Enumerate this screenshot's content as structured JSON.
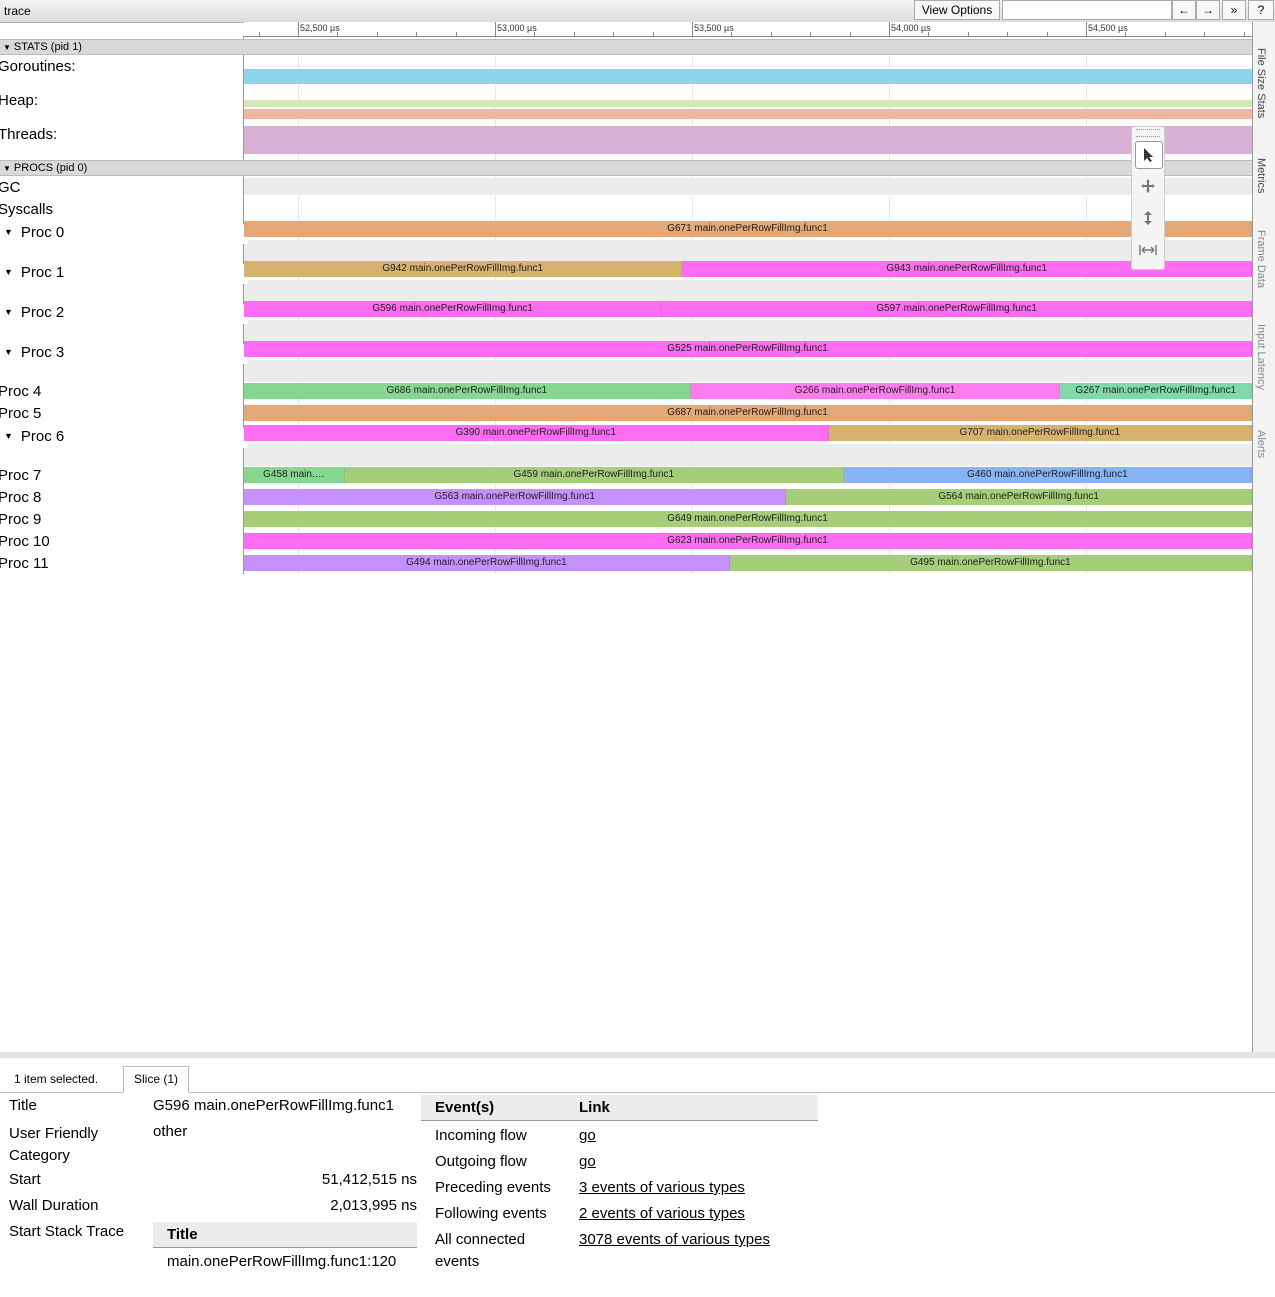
{
  "header": {
    "title": "trace",
    "view_options": "View Options",
    "search_value": "",
    "nav_back": "←",
    "nav_forward": "→",
    "nav_more": "»",
    "help": "?"
  },
  "ruler": {
    "ticks": [
      {
        "label": "52,500 µs",
        "value": 52500
      },
      {
        "label": "53,000 µs",
        "value": 53000
      },
      {
        "label": "53,500 µs",
        "value": 53500
      },
      {
        "label": "54,000 µs",
        "value": 54000
      },
      {
        "label": "54,500 µs",
        "value": 54500
      }
    ]
  },
  "stats": {
    "header": "STATS (pid 1)",
    "rows": [
      {
        "label": "Goroutines:",
        "color": "#8ed4ea"
      },
      {
        "label": "Heap:",
        "colors": [
          "#d5e6b8",
          "#eeb8a0"
        ]
      },
      {
        "label": "Threads:",
        "color": "#d8b0d6"
      }
    ]
  },
  "procs": {
    "header": "PROCS (pid 0)",
    "rows": [
      {
        "label": "GC",
        "expandable": false
      },
      {
        "label": "Syscalls",
        "expandable": false
      },
      {
        "label": "Proc 0",
        "expandable": true,
        "slices": [
          {
            "label": "G671 main.onePerRowFillImg.func1",
            "start": 0,
            "end": 1,
            "color": "#e2a878"
          }
        ]
      },
      {
        "label": "Proc 1",
        "expandable": true,
        "slices": [
          {
            "label": "G942 main.onePerRowFillImg.func1",
            "start": 0,
            "end": 0.435,
            "color": "#d5b36e"
          },
          {
            "label": "G943 main.onePerRowFillImg.func1",
            "start": 0.435,
            "end": 1,
            "color": "#fe6cf1"
          }
        ]
      },
      {
        "label": "Proc 2",
        "expandable": true,
        "slices": [
          {
            "label": "G596 main.onePerRowFillImg.func1",
            "start": 0,
            "end": 0.415,
            "color": "#fe6cf1"
          },
          {
            "label": "G597 main.onePerRowFillImg.func1",
            "start": 0.415,
            "end": 1,
            "color": "#fe6cf1"
          }
        ]
      },
      {
        "label": "Proc 3",
        "expandable": true,
        "slices": [
          {
            "label": "G525 main.onePerRowFillImg.func1",
            "start": 0,
            "end": 1,
            "color": "#fe6cf1"
          }
        ]
      },
      {
        "label": "Proc 4",
        "expandable": false,
        "slices": [
          {
            "label": "G686 main.onePerRowFillImg.func1",
            "start": 0,
            "end": 0.443,
            "color": "#86d890"
          },
          {
            "label": "G266 main.onePerRowFillImg.func1",
            "start": 0.443,
            "end": 0.81,
            "color": "#fe7cf0"
          },
          {
            "label": "G267 main.onePerRowFillImg.func1",
            "start": 0.81,
            "end": 1,
            "color": "#7edba9"
          }
        ]
      },
      {
        "label": "Proc 5",
        "expandable": false,
        "slices": [
          {
            "label": "G687 main.onePerRowFillImg.func1",
            "start": 0,
            "end": 1,
            "color": "#e2a878"
          }
        ]
      },
      {
        "label": "Proc 6",
        "expandable": true,
        "slices": [
          {
            "label": "G390 main.onePerRowFillImg.func1",
            "start": 0,
            "end": 0.58,
            "color": "#fe6cf1"
          },
          {
            "label": "G707 main.onePerRowFillImg.func1",
            "start": 0.58,
            "end": 1,
            "color": "#d5b36e"
          }
        ]
      },
      {
        "label": "Proc 7",
        "expandable": false,
        "slices": [
          {
            "label": "G458 main.…",
            "start": 0,
            "end": 0.1,
            "color": "#86d890"
          },
          {
            "label": "G459 main.onePerRowFillImg.func1",
            "start": 0.1,
            "end": 0.595,
            "color": "#a6cd77"
          },
          {
            "label": "G460 main.onePerRowFillImg.func1",
            "start": 0.595,
            "end": 1,
            "color": "#87b4f6"
          }
        ]
      },
      {
        "label": "Proc 8",
        "expandable": false,
        "slices": [
          {
            "label": "G563 main.onePerRowFillImg.func1",
            "start": 0,
            "end": 0.538,
            "color": "#c491fa"
          },
          {
            "label": "G564 main.onePerRowFillImg.func1",
            "start": 0.538,
            "end": 1,
            "color": "#a6cd77"
          }
        ]
      },
      {
        "label": "Proc 9",
        "expandable": false,
        "slices": [
          {
            "label": "G649 main.onePerRowFillImg.func1",
            "start": 0,
            "end": 1,
            "color": "#a6cd77"
          }
        ]
      },
      {
        "label": "Proc 10",
        "expandable": false,
        "slices": [
          {
            "label": "G623 main.onePerRowFillImg.func1",
            "start": 0,
            "end": 1,
            "color": "#fe6cf1"
          }
        ]
      },
      {
        "label": "Proc 11",
        "expandable": false,
        "slices": [
          {
            "label": "G494 main.onePerRowFillImg.func1",
            "start": 0,
            "end": 0.482,
            "color": "#c491fa"
          },
          {
            "label": "G495 main.onePerRowFillImg.func1",
            "start": 0.482,
            "end": 1,
            "color": "#a6cd77"
          }
        ]
      }
    ]
  },
  "side_tabs": [
    "File Size Stats",
    "Metrics",
    "Frame Data",
    "Input Latency",
    "Alerts"
  ],
  "tools": [
    "pointer-icon",
    "pan-icon",
    "zoom-icon",
    "timing-icon"
  ],
  "details": {
    "selection_summary": "1 item selected.",
    "tab_label": "Slice (1)",
    "title_label": "Title",
    "title_value": "G596 main.onePerRowFillImg.func1",
    "category_label": "User Friendly Category",
    "category_value": "other",
    "start_label": "Start",
    "start_value": "51,412,515 ns",
    "duration_label": "Wall Duration",
    "duration_value": "2,013,995 ns",
    "stack_label": "Start Stack Trace",
    "stack_header": "Title",
    "stack_frame": "main.onePerRowFillImg.func1:120",
    "events_header": "Event(s)",
    "link_header": "Link",
    "events": [
      {
        "event": "Incoming flow",
        "link": "go"
      },
      {
        "event": "Outgoing flow",
        "link": "go"
      },
      {
        "event": "Preceding events",
        "link": "3 events of various types"
      },
      {
        "event": "Following events",
        "link": "2 events of various types"
      },
      {
        "event": "All connected events",
        "link": "3078 events of various types"
      }
    ]
  }
}
